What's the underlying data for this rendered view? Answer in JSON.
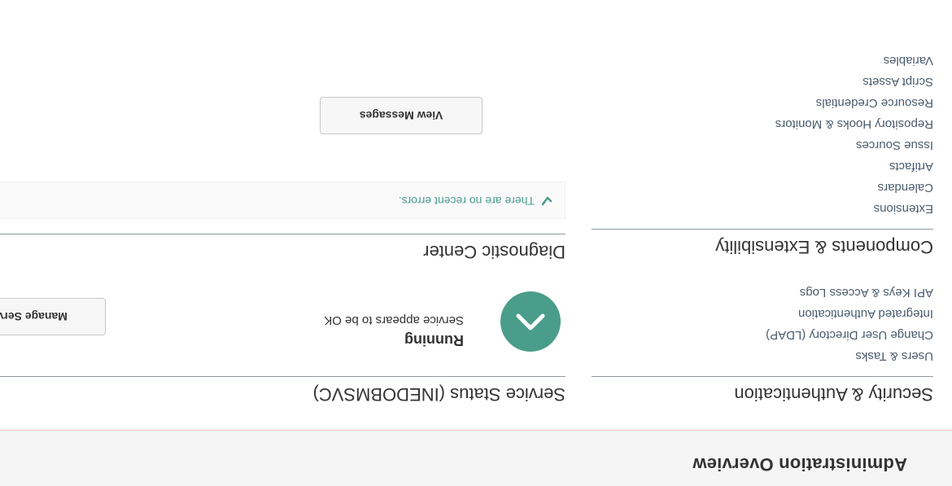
{
  "header": {
    "title": "Administration Overview"
  },
  "security": {
    "heading": "Security & Authentication",
    "items": [
      {
        "label": "Users & Tasks"
      },
      {
        "label": "Change User Directory (LDAP)"
      },
      {
        "label": "Integrated Authentication"
      },
      {
        "label": "API Keys & Access Logs"
      }
    ]
  },
  "components": {
    "heading": "Components & Extensibility",
    "items": [
      {
        "label": "Extensions"
      },
      {
        "label": "Calendars"
      },
      {
        "label": "Artifacts"
      },
      {
        "label": "Issue Sources"
      },
      {
        "label": "Repository Hooks & Monitors"
      },
      {
        "label": "Resource Credentials"
      },
      {
        "label": "Script Assets"
      },
      {
        "label": "Variables"
      }
    ]
  },
  "service": {
    "heading": "Service Status (INEDOBMSVC)",
    "status_title": "Running",
    "status_desc": "Service appears to be OK",
    "manage_button": "Manage Service",
    "status_icon": "chevron-up-icon",
    "status_color": "#4a9d8a"
  },
  "diagnostic": {
    "heading": "Diagnostic Center",
    "errors_text": "There are no recent errors.",
    "errors_icon": "checkmark-icon",
    "messages_button": "View Messages"
  },
  "colors": {
    "accent": "#4a9d8a",
    "header_bg": "#f5f5f5",
    "header_border": "#f3c9b8",
    "link": "#4a5b6c"
  }
}
